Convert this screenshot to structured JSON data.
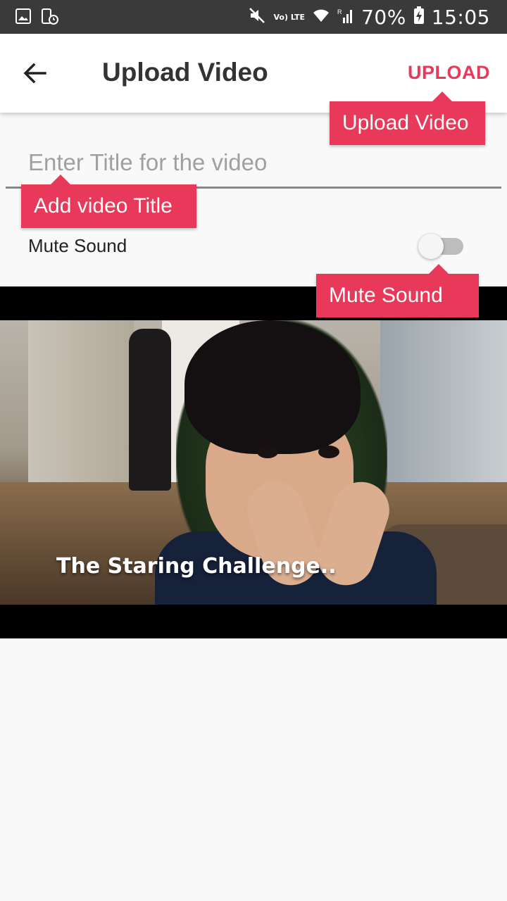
{
  "status_bar": {
    "battery": "70%",
    "time": "15:05",
    "network": "Vo) LTE",
    "signal_badge": "R"
  },
  "header": {
    "title": "Upload Video",
    "upload_label": "UPLOAD"
  },
  "form": {
    "title_placeholder": "Enter Title for the video",
    "title_value": "",
    "mute_label": "Mute Sound",
    "mute_on": false
  },
  "tooltips": {
    "upload": "Upload Video",
    "title": "Add video Title",
    "mute": "Mute Sound"
  },
  "video": {
    "caption": "The Staring Challenge.."
  },
  "colors": {
    "accent": "#e8395a",
    "status_bar": "#3a3a3a"
  }
}
